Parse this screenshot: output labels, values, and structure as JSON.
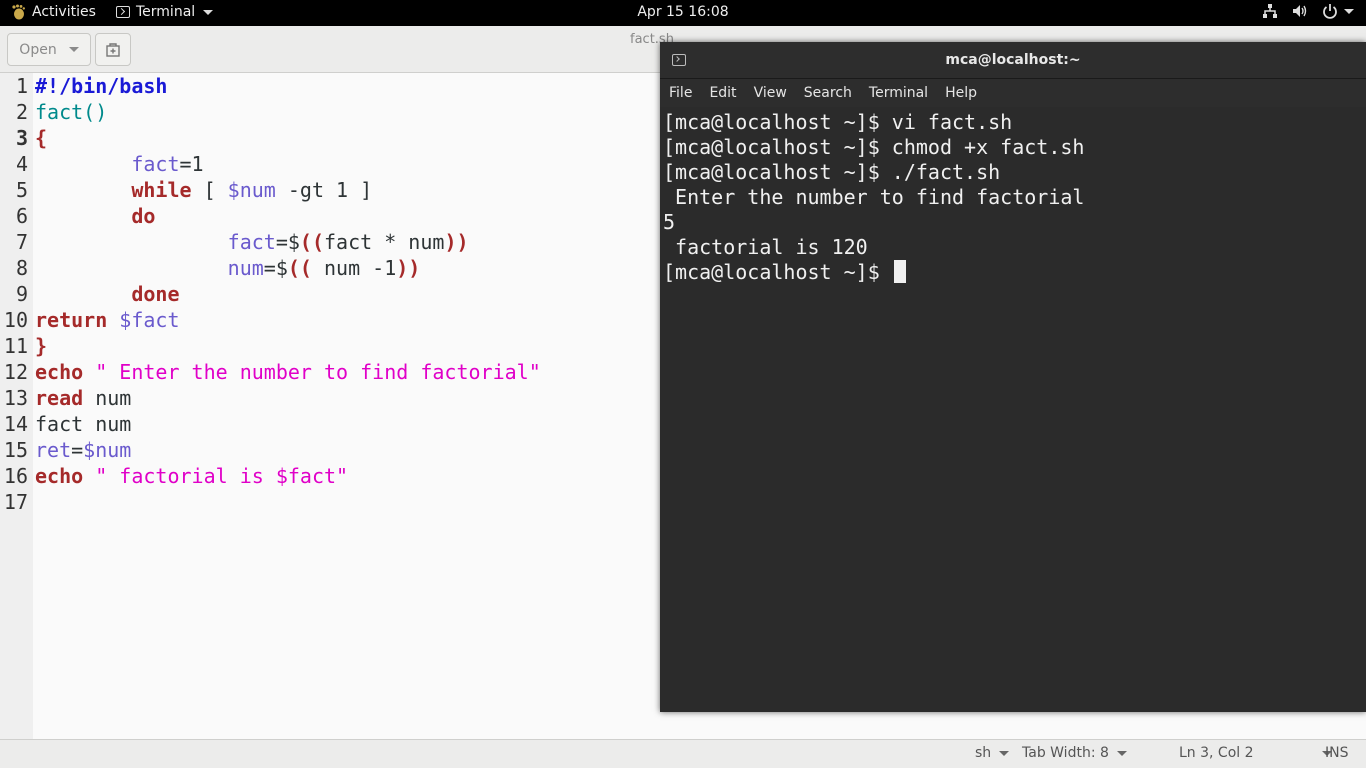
{
  "topbar": {
    "activities": "Activities",
    "app_menu": "Terminal",
    "clock": "Apr 15  16:08",
    "tray_icons": [
      "network-icon",
      "volume-icon",
      "power-icon"
    ]
  },
  "gedit": {
    "open_label": "Open",
    "title": "fact.sh",
    "line_numbers": [
      "1",
      "2",
      "3",
      "4",
      "5",
      "6",
      "7",
      "8",
      "9",
      "10",
      "11",
      "12",
      "13",
      "14",
      "15",
      "16",
      "17"
    ],
    "code": {
      "l1": "#!/bin/bash",
      "l2": "fact()",
      "l3": "{",
      "l4_var": "fact",
      "l4_rest": "=1",
      "l5_kw": "while",
      "l5_a": " [ ",
      "l5_var": "$num",
      "l5_b": " -gt 1 ]",
      "l6": "do",
      "l7_var": "fact",
      "l7_a": "=$",
      "l7_p1": "((",
      "l7_b": "fact * num",
      "l7_p2": "))",
      "l8_var": "num",
      "l8_a": "=$",
      "l8_p1": "((",
      "l8_b": " num -1",
      "l8_p2": "))",
      "l9": "done",
      "l10_kw": "return",
      "l10_var": "$fact",
      "l11": "}",
      "l12_kw": "echo",
      "l12_str": "\" Enter the number to find factorial\"",
      "l13_kw": "read",
      "l13_rest": " num",
      "l14": "fact num",
      "l15_var": "ret",
      "l15_a": "=",
      "l15_var2": "$num",
      "l16_kw": "echo",
      "l16_str": "\" factorial is $fact\""
    },
    "status": {
      "language": "sh",
      "tab_width": "Tab Width: 8",
      "position": "Ln 3, Col 2",
      "mode": "INS"
    }
  },
  "terminal": {
    "title": "mca@localhost:~",
    "menu": [
      "File",
      "Edit",
      "View",
      "Search",
      "Terminal",
      "Help"
    ],
    "lines": [
      "[mca@localhost ~]$ vi fact.sh",
      "[mca@localhost ~]$ chmod +x fact.sh",
      "[mca@localhost ~]$ ./fact.sh",
      " Enter the number to find factorial",
      "5",
      " factorial is 120",
      "[mca@localhost ~]$ "
    ]
  }
}
